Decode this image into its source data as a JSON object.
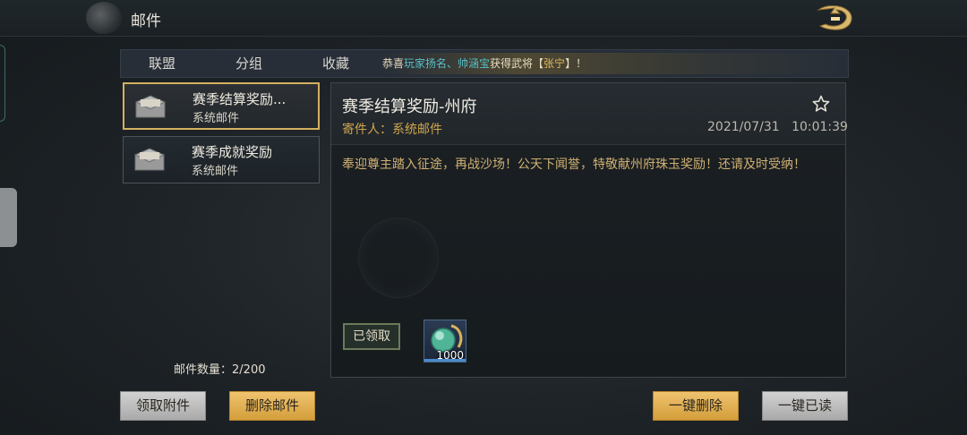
{
  "header": {
    "title": "邮件"
  },
  "tabs": [
    {
      "label": "联盟"
    },
    {
      "label": "分组"
    },
    {
      "label": "收藏"
    }
  ],
  "broadcast": {
    "prefix": "恭喜",
    "players": "玩家扬名、帅涵宝",
    "middle": "获得武将【",
    "general": "张宁",
    "suffix": "】！"
  },
  "mail_list": {
    "items": [
      {
        "subject": "赛季结算奖励...",
        "sender": "系统邮件",
        "selected": true
      },
      {
        "subject": "赛季成就奖励",
        "sender": "系统邮件",
        "selected": false
      }
    ],
    "count_label": "邮件数量：",
    "count_value": "2/200"
  },
  "detail": {
    "title": "赛季结算奖励-州府",
    "sender_label": "寄件人：系统邮件",
    "date": "2021/07/31",
    "time": "10:01:39",
    "body": "奉迎尊主踏入征途，再战沙场！公天下闻誉，特敬献州府珠玉奖励！还请及时受纳！",
    "status": "已领取",
    "reward": {
      "icon": "jade-orb-icon",
      "quantity": "1000"
    }
  },
  "buttons": {
    "claim": "领取附件",
    "delete": "删除邮件",
    "delete_all": "一键删除",
    "read_all": "一键已读"
  },
  "colors": {
    "accent_gold": "#d4b160",
    "sender_gold": "#d0a64d",
    "broadcast_teal": "#57c0c8"
  }
}
